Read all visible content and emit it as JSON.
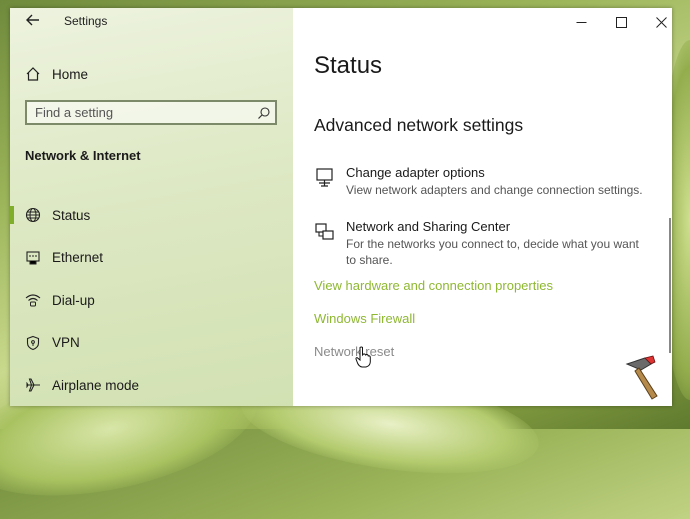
{
  "window": {
    "app_title": "Settings"
  },
  "sidebar": {
    "home_label": "Home",
    "search_placeholder": "Find a setting",
    "section_title": "Network & Internet",
    "items": [
      {
        "label": "Status",
        "icon": "globe-icon",
        "active": true
      },
      {
        "label": "Ethernet",
        "icon": "ethernet-icon",
        "active": false
      },
      {
        "label": "Dial-up",
        "icon": "dialup-icon",
        "active": false
      },
      {
        "label": "VPN",
        "icon": "vpn-icon",
        "active": false
      },
      {
        "label": "Airplane mode",
        "icon": "airplane-icon",
        "active": false
      }
    ]
  },
  "content": {
    "page_title": "Status",
    "section_heading": "Advanced network settings",
    "options": [
      {
        "title": "Change adapter options",
        "description": "View network adapters and change connection settings.",
        "icon": "adapter-icon"
      },
      {
        "title": "Network and Sharing Center",
        "description": "For the networks you connect to, decide what you want to share.",
        "icon": "sharing-center-icon"
      }
    ],
    "links": [
      {
        "label": "View hardware and connection properties",
        "color": "#8fb832"
      },
      {
        "label": "Windows Firewall",
        "color": "#8fb832"
      },
      {
        "label": "Network reset",
        "color": "#8a8a8a"
      }
    ]
  },
  "colors": {
    "accent": "#7fae2a",
    "link": "#8fb832"
  }
}
